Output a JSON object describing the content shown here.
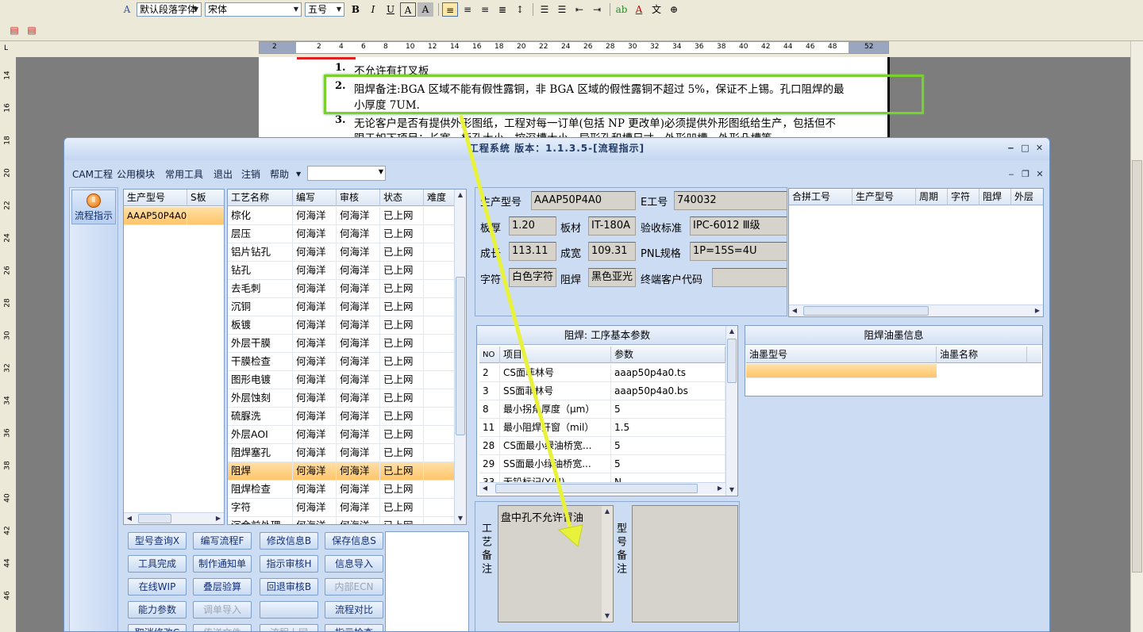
{
  "word": {
    "style_combo": "默认段落字体",
    "font_combo": "宋体",
    "size_combo": "五号",
    "format_buttons": [
      "B",
      "I",
      "U",
      "A",
      "A"
    ],
    "ruler_numbers": [
      "2",
      "2",
      "4",
      "6",
      "8",
      "10",
      "12",
      "14",
      "16",
      "18",
      "20",
      "22",
      "24",
      "26",
      "28",
      "30",
      "32",
      "34",
      "36",
      "38",
      "40",
      "42",
      "44",
      "46",
      "48",
      "52"
    ],
    "vruler_numbers": [
      "14",
      "16",
      "18",
      "20",
      "22",
      "24",
      "26",
      "28",
      "30",
      "32",
      "34",
      "36",
      "38",
      "40",
      "42",
      "44",
      "46"
    ],
    "doc": {
      "item1_num": "1.",
      "item1_text": "不允许有打叉板",
      "item2_num": "2.",
      "item2_line1": "阻焊备注:BGA 区域不能有假性露铜，非 BGA 区域的假性露铜不超过 5%，保证不上锡。孔口阻焊的最",
      "item2_line2": "小厚度 7UM.",
      "item3_num": "3.",
      "item3_line1": "无论客户是否有提供外形图纸，工程对每一订单(包括 NP 更改单)必须提供外形图纸给生产，包括但不",
      "item3_line2": "限于如下项目：长宽、板孔大小、控深槽大小、异形孔和槽尺寸、外形凹槽、外形凸槽等。"
    }
  },
  "cam": {
    "title": "工程系统 版本：1.1.3.5-[流程指示]",
    "menu": [
      "CAM工程",
      "公用模块",
      "常用工具",
      "退出",
      "注销",
      "帮助"
    ],
    "nav_button": "流程指示",
    "model_grid": {
      "headers": [
        "生产型号",
        "S板"
      ],
      "rows": [
        [
          "AAAP50P4A0",
          ""
        ]
      ]
    },
    "process_grid": {
      "headers": [
        "工艺名称",
        "编写",
        "审核",
        "状态",
        "难度"
      ],
      "rows": [
        [
          "棕化",
          "何海洋",
          "何海洋",
          "已上网",
          ""
        ],
        [
          "层压",
          "何海洋",
          "何海洋",
          "已上网",
          ""
        ],
        [
          "铝片钻孔",
          "何海洋",
          "何海洋",
          "已上网",
          ""
        ],
        [
          "钻孔",
          "何海洋",
          "何海洋",
          "已上网",
          ""
        ],
        [
          "去毛刺",
          "何海洋",
          "何海洋",
          "已上网",
          ""
        ],
        [
          "沉铜",
          "何海洋",
          "何海洋",
          "已上网",
          ""
        ],
        [
          "板镀",
          "何海洋",
          "何海洋",
          "已上网",
          ""
        ],
        [
          "外层干膜",
          "何海洋",
          "何海洋",
          "已上网",
          ""
        ],
        [
          "干膜检查",
          "何海洋",
          "何海洋",
          "已上网",
          ""
        ],
        [
          "图形电镀",
          "何海洋",
          "何海洋",
          "已上网",
          ""
        ],
        [
          "外层蚀刻",
          "何海洋",
          "何海洋",
          "已上网",
          ""
        ],
        [
          "硫脲洗",
          "何海洋",
          "何海洋",
          "已上网",
          ""
        ],
        [
          "外层AOI",
          "何海洋",
          "何海洋",
          "已上网",
          ""
        ],
        [
          "阻焊塞孔",
          "何海洋",
          "何海洋",
          "已上网",
          ""
        ],
        [
          "阻焊",
          "何海洋",
          "何海洋",
          "已上网",
          ""
        ],
        [
          "阻焊检查",
          "何海洋",
          "何海洋",
          "已上网",
          ""
        ],
        [
          "字符",
          "何海洋",
          "何海洋",
          "已上网",
          ""
        ],
        [
          "沉金前处理",
          "何海洋",
          "何海洋",
          "已上网",
          ""
        ]
      ],
      "selected_index": 14
    },
    "buttons": [
      [
        "型号查询X",
        "编写流程F",
        "修改信息B",
        "保存信息S"
      ],
      [
        "工具完成",
        "制作通知单",
        "指示审核H",
        "信息导入"
      ],
      [
        "在线WIP",
        "叠层验算",
        "回退审核B",
        "内部ECN"
      ],
      [
        "能力参数",
        "调单导入",
        "",
        "流程对比"
      ],
      [
        "取消修改C",
        "传送文件",
        "流程上网",
        "指示检查"
      ]
    ],
    "info": {
      "model_label": "生产型号",
      "model_value": "AAAP50P4A0",
      "eno_label": "E工号",
      "eno_value": "740032",
      "thick_label": "板厚",
      "thick_value": "1.20",
      "material_label": "板材",
      "material_value": "IT-180A",
      "std_label": "验收标准",
      "std_value": "IPC-6012 Ⅲ级",
      "len_label": "成长",
      "len_value": "113.11",
      "wid_label": "成宽",
      "wid_value": "109.31",
      "pnl_label": "PNL规格",
      "pnl_value": "1P=15S=4U",
      "char_label": "字符",
      "char_value": "白色字符",
      "mask_label": "阻焊",
      "mask_value": "黑色亚光",
      "cust_label": "终端客户代码",
      "cust_value": ""
    },
    "combine_grid": {
      "headers": [
        "合拼工号",
        "生产型号",
        "周期",
        "字符",
        "阻焊",
        "外层"
      ]
    },
    "params": {
      "title": "阻焊: 工序基本参数",
      "headers": [
        "NO",
        "项目",
        "参数"
      ],
      "rows": [
        [
          "2",
          "CS面菲林号",
          "aaap50p4a0.ts"
        ],
        [
          "3",
          "SS面菲林号",
          "aaap50p4a0.bs"
        ],
        [
          "8",
          "最小拐角厚度（μm）",
          "5"
        ],
        [
          "11",
          "最小阻焊开窗（mil）",
          "1.5"
        ],
        [
          "28",
          "CS面最小绿油桥宽...",
          "5"
        ],
        [
          "29",
          "SS面最小绿油桥宽...",
          "5"
        ],
        [
          "33",
          "无铅标记(Y/N)",
          "N"
        ]
      ]
    },
    "ink": {
      "title": "阻焊油墨信息",
      "headers": [
        "油墨型号",
        "油墨名称"
      ]
    },
    "notes": {
      "process_label": "工艺备注",
      "process_text": "盘中孔不允许冒油",
      "model_label": "型号备注"
    }
  },
  "colors": {
    "highlight_box": "#7ad12c",
    "arrow": "#e8f23a",
    "selected_row": "#ffc56a"
  }
}
